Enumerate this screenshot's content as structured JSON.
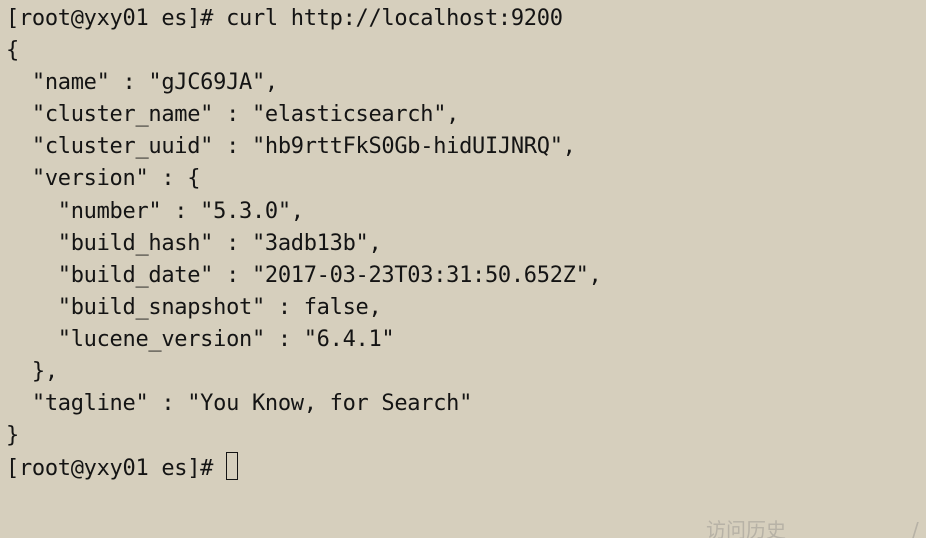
{
  "terminal": {
    "lines": [
      "[root@yxy01 es]# curl http://localhost:9200",
      "{",
      "  \"name\" : \"gJC69JA\",",
      "  \"cluster_name\" : \"elasticsearch\",",
      "  \"cluster_uuid\" : \"hb9rttFkS0Gb-hidUIJNRQ\",",
      "  \"version\" : {",
      "    \"number\" : \"5.3.0\",",
      "    \"build_hash\" : \"3adb13b\",",
      "    \"build_date\" : \"2017-03-23T03:31:50.652Z\",",
      "    \"build_snapshot\" : false,",
      "    \"lucene_version\" : \"6.4.1\"",
      "  },",
      "  \"tagline\" : \"You Know, for Search\"",
      "}"
    ],
    "prompt": "[root@yxy01 es]# "
  },
  "overlay": {
    "history_label": "访问历史",
    "slash": "/"
  },
  "colors": {
    "background": "#d6cfbd",
    "text": "#141414"
  }
}
